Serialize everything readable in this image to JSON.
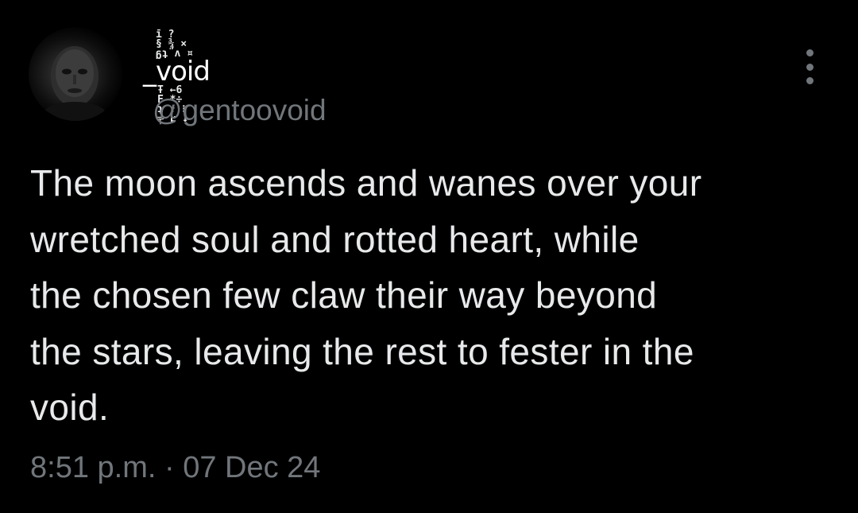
{
  "user": {
    "display_name": "_void",
    "handle": "@gentoovoid",
    "avatar": "profile-photo"
  },
  "tweet": {
    "text_lines": [
      "The moon ascends and wanes over your",
      "wretched soul and rotted heart, while",
      "the chosen few claw their way beyond",
      "the stars, leaving the rest to fester in the",
      "void."
    ],
    "time": "8:51 p.m.",
    "separator": "·",
    "date": "07 Dec 24"
  },
  "icons": {
    "more": "more-vertical-icon"
  },
  "colors": {
    "background": "#000000",
    "text_primary": "#e7e9ea",
    "text_secondary": "#71767b"
  }
}
